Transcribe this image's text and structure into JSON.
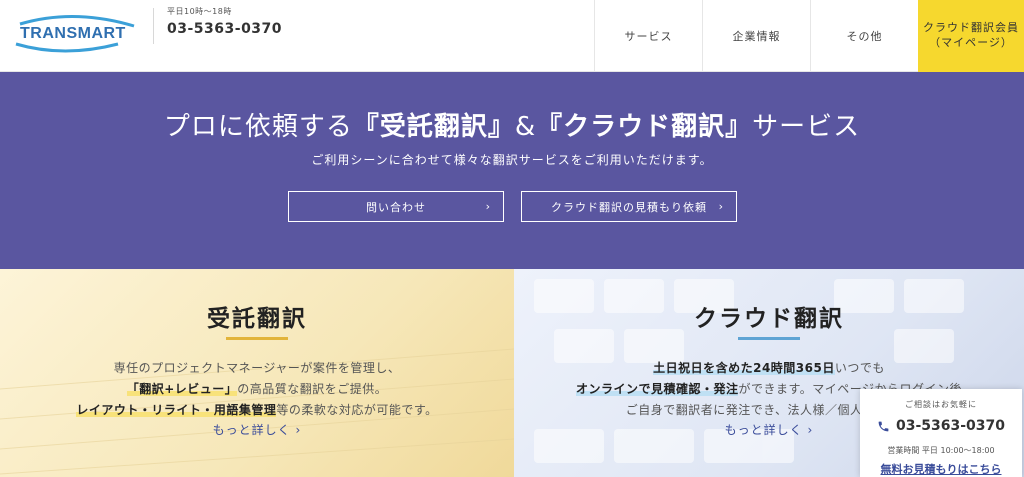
{
  "header": {
    "logo_text": "TRANSMART",
    "tel_hours": "平日10時〜18時",
    "tel_number": "03-5363-0370",
    "nav": [
      {
        "label": "サービス"
      },
      {
        "label": "企業情報"
      },
      {
        "label": "その他"
      }
    ],
    "member": {
      "line1": "クラウド翻訳会員",
      "line2": "（マイページ）"
    }
  },
  "hero": {
    "title_pre": "プロに依頼する",
    "title_b1": "『受託翻訳』",
    "title_amp": "&",
    "title_b2": "『クラウド翻訳』",
    "title_post": "サービス",
    "subtitle": "ご利用シーンに合わせて様々な翻訳サービスをご利用いただけます。",
    "btn_contact": "問い合わせ",
    "btn_estimate": "クラウド翻訳の見積もり依頼"
  },
  "panels": {
    "left": {
      "title": "受託翻訳",
      "line1": "専任のプロジェクトマネージャーが案件を管理し、",
      "line2_hl": "「翻訳+レビュー」",
      "line2_rest": "の高品質な翻訳をご提供。",
      "line3_hl": "レイアウト・リライト・用語集管理",
      "line3_rest": "等の柔軟な対応が可能です。",
      "more": "もっと詳しく"
    },
    "right": {
      "title": "クラウド翻訳",
      "line1_hl": "土日祝日を含めた24時間365日",
      "line1_rest": "いつでも",
      "line2_hl": "オンラインで見積確認・発注",
      "line2_rest": "ができます。マイページからログイン後",
      "line3": "ご自身で翻訳者に発注でき、法人様／個人様にご利",
      "more": "もっと詳しく"
    }
  },
  "float_contact": {
    "label": "ご相談はお気軽に",
    "tel": "03-5363-0370",
    "hours": "営業時間 平日 10:00～18:00",
    "link": "無料お見積もりはこちら"
  },
  "colors": {
    "hero_bg": "#5a56a0",
    "member_bg": "#f6d82e",
    "accent_yellow": "#e2b43a",
    "accent_blue": "#5fa4d4",
    "link": "#3a4c9a"
  }
}
